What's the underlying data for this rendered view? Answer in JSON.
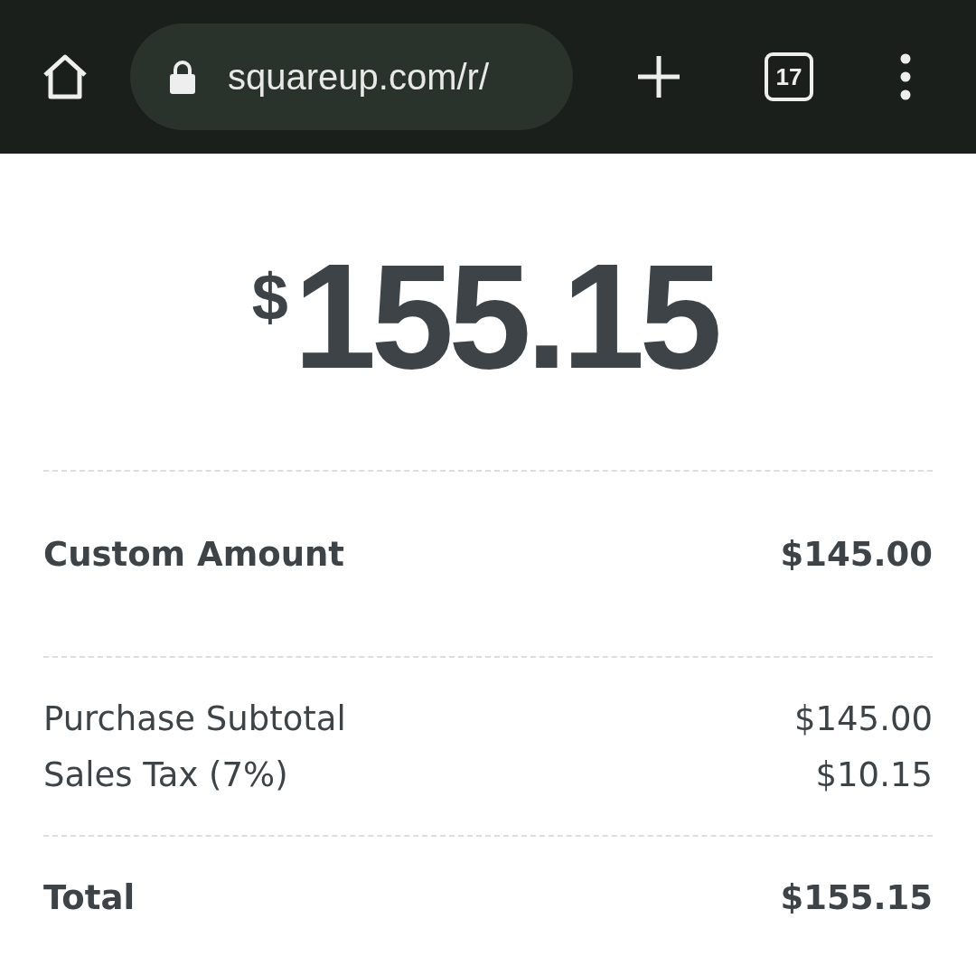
{
  "browser": {
    "url": "squareup.com/r/",
    "tab_count": "17"
  },
  "amount": {
    "symbol": "$",
    "value": "155.15"
  },
  "sections": [
    {
      "kind": "emphasis",
      "rows": [
        {
          "label": "Custom Amount",
          "amount": "$145.00"
        }
      ]
    },
    {
      "kind": "plain",
      "rows": [
        {
          "label": "Purchase Subtotal",
          "amount": "$145.00"
        },
        {
          "label": "Sales Tax (7%)",
          "amount": "$10.15"
        }
      ]
    },
    {
      "kind": "emphasis",
      "rows": [
        {
          "label": "Total",
          "amount": "$155.15"
        }
      ]
    }
  ]
}
